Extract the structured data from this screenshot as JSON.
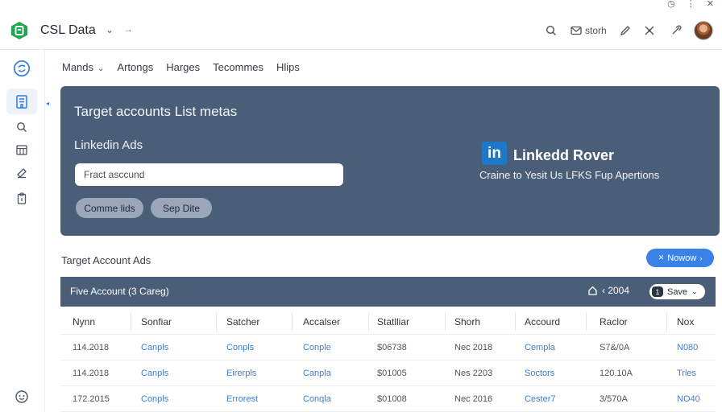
{
  "window": {
    "controls": [
      "◷",
      "⋮",
      "✕"
    ]
  },
  "app": {
    "title": "CSL Data",
    "title_menu": "⌄",
    "title_arrow": "→"
  },
  "toolbar": {
    "share_label": "storh"
  },
  "nav": {
    "tabs": [
      {
        "label": "Mands",
        "has_dropdown": true
      },
      {
        "label": "Artongs"
      },
      {
        "label": "Harges"
      },
      {
        "label": "Tecommes"
      },
      {
        "label": "Hlips"
      }
    ]
  },
  "hero": {
    "title": "Target accounts List metas",
    "subtitle": "Linkedin Ads",
    "input_placeholder": "Fract asccund",
    "buttons": [
      "Comme lids",
      "Sep Dite"
    ],
    "brand_badge": "in",
    "brand_title": "Linkedd Rover",
    "brand_subtitle": "Craine to Yesit Us LFKS Fup Apertions"
  },
  "section": {
    "title": "Target Account Ads",
    "primary_button": "Nowow",
    "primary_icon": "✕"
  },
  "table": {
    "header_title": "Five Account (3 Careg)",
    "header_filter": "‹ 2004",
    "header_select": "Save",
    "header_select_tag": "1",
    "columns": [
      "Nynn",
      "Sonfiar",
      "Satcher",
      "Accalser",
      "Statlliar",
      "Shorh",
      "Accourd",
      "Raclor",
      "Nox"
    ],
    "rows": [
      [
        "114.2018",
        "Canpls",
        "Conpls",
        "Conple",
        "$06738",
        "Nec 2018",
        "Cempla",
        "S7&/0A",
        "N080"
      ],
      [
        "114.2018",
        "Canpls",
        "Eirerpls",
        "Canpla",
        "$01005",
        "Nes 2203",
        "Soctors",
        "120.10A",
        "Trles"
      ],
      [
        "172.2015",
        "Conpls",
        "Errorest",
        "Conqla",
        "$01008",
        "Nec 2016",
        "Cester7",
        "3/570A",
        "NO40"
      ]
    ],
    "link_columns": [
      1,
      2,
      3,
      6,
      8
    ]
  },
  "colors": {
    "accent": "#3b82e8",
    "panel": "#4a5e78",
    "link": "#3c7fd4",
    "logo": "#1ea84d",
    "linkedin": "#1c78c8"
  }
}
